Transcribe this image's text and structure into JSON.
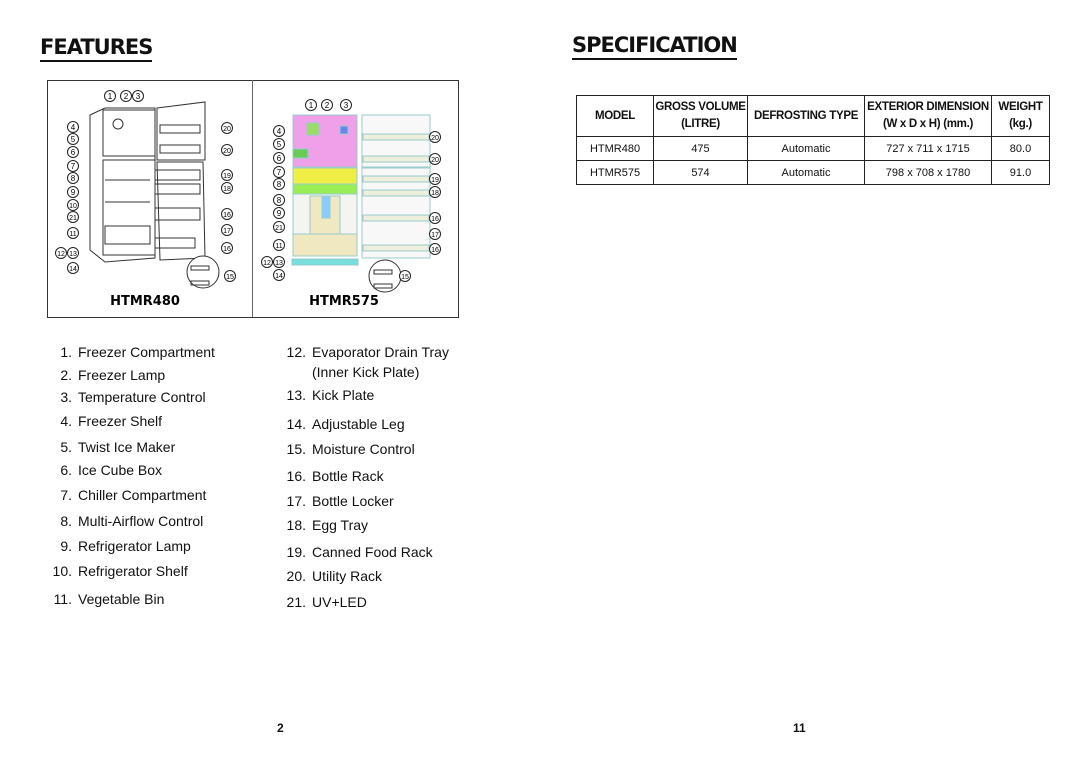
{
  "features": {
    "title": "FEATURES",
    "diagrams": {
      "left": {
        "model": "HTMR480",
        "callouts": [
          "1",
          "2",
          "3",
          "4",
          "5",
          "6",
          "7",
          "8",
          "9",
          "10",
          "21",
          "11",
          "12",
          "13",
          "14",
          "20",
          "20",
          "19",
          "18",
          "16",
          "17",
          "16",
          "15"
        ]
      },
      "right": {
        "model": "HTMR575",
        "callouts": [
          "1",
          "2",
          "3",
          "4",
          "5",
          "6",
          "7",
          "8",
          "8",
          "9",
          "21",
          "11",
          "12",
          "13",
          "14",
          "20",
          "20",
          "19",
          "18",
          "16",
          "17",
          "16",
          "15"
        ]
      }
    },
    "parts_col1": [
      {
        "num": "1.",
        "label": "Freezer Compartment"
      },
      {
        "num": "2.",
        "label": "Freezer Lamp"
      },
      {
        "num": "3.",
        "label": "Temperature Control"
      },
      {
        "num": "4.",
        "label": "Freezer Shelf"
      },
      {
        "num": "5.",
        "label": "Twist Ice Maker"
      },
      {
        "num": "6.",
        "label": "Ice Cube Box"
      },
      {
        "num": "7.",
        "label": "Chiller Compartment"
      },
      {
        "num": "8.",
        "label": "Multi-Airflow Control"
      },
      {
        "num": "9.",
        "label": "Refrigerator Lamp"
      },
      {
        "num": "10.",
        "label": "Refrigerator Shelf"
      },
      {
        "num": "11.",
        "label": "Vegetable Bin"
      }
    ],
    "parts_col2": [
      {
        "num": "12.",
        "label": "Evaporator Drain Tray"
      },
      {
        "num": "",
        "label": "(Inner Kick Plate)"
      },
      {
        "num": "13.",
        "label": "Kick Plate"
      },
      {
        "num": "14.",
        "label": "Adjustable Leg"
      },
      {
        "num": "15.",
        "label": "Moisture Control"
      },
      {
        "num": "16.",
        "label": "Bottle Rack"
      },
      {
        "num": "17.",
        "label": "Bottle Locker"
      },
      {
        "num": "18.",
        "label": "Egg Tray"
      },
      {
        "num": "19.",
        "label": "Canned Food Rack"
      },
      {
        "num": "20.",
        "label": "Utility Rack"
      },
      {
        "num": "21.",
        "label": "UV+LED"
      }
    ],
    "page_number": "2"
  },
  "specification": {
    "title": "SPECIFICATION",
    "headers": [
      {
        "line1": "MODEL",
        "line2": ""
      },
      {
        "line1": "GROSS VOLUME",
        "line2": "(LITRE)"
      },
      {
        "line1": "DEFROSTING TYPE",
        "line2": ""
      },
      {
        "line1": "EXTERIOR DIMENSION",
        "line2": "(W x D x H) (mm.)"
      },
      {
        "line1": "WEIGHT",
        "line2": "(kg.)"
      }
    ],
    "rows": [
      [
        "HTMR480",
        "475",
        "Automatic",
        "727 x 711 x 1715",
        "80.0"
      ],
      [
        "HTMR575",
        "574",
        "Automatic",
        "798 x 708 x 1780",
        "91.0"
      ]
    ],
    "page_number": "11"
  }
}
